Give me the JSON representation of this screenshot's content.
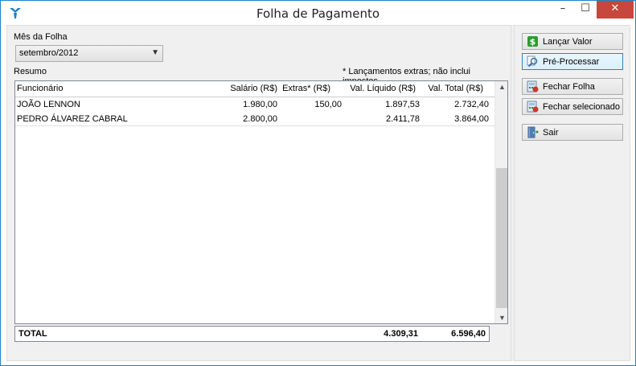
{
  "window": {
    "title": "Folha de Pagamento",
    "minimize": "–",
    "maximize": "☐",
    "close": "✕"
  },
  "form": {
    "month_label": "Mês da Folha",
    "month_value": "setembro/2012",
    "summary_label": "Resumo",
    "note": "* Lançamentos extras; não inclui impostos."
  },
  "table": {
    "headers": [
      "Funcionário",
      "Salário (R$)",
      "Extras* (R$)",
      "Val. Líquido (R$)",
      "Val. Total (R$)"
    ],
    "rows": [
      [
        "JOÃO LENNON",
        "1.980,00",
        "150,00",
        "1.897,53",
        "2.732,40"
      ],
      [
        "PEDRO ÁLVAREZ CABRAL",
        "2.800,00",
        "",
        "2.411,78",
        "3.864,00"
      ]
    ],
    "total": {
      "label": "TOTAL",
      "liquido": "4.309,31",
      "total": "6.596,40"
    }
  },
  "buttons": {
    "lancar": "Lançar Valor",
    "preprocessar": "Pré-Processar",
    "fechar_folha": "Fechar Folha",
    "fechar_selecionado": "Fechar selecionado",
    "sair": "Sair"
  },
  "icons": {
    "app": "app-logo-icon",
    "lancar": "money-icon",
    "preprocessar": "magnifier-icon",
    "fechar": "calculator-icon",
    "sair": "exit-door-icon"
  },
  "colors": {
    "accent": "#1c83c6",
    "close": "#c7463e",
    "money": "#2e9b2e"
  }
}
